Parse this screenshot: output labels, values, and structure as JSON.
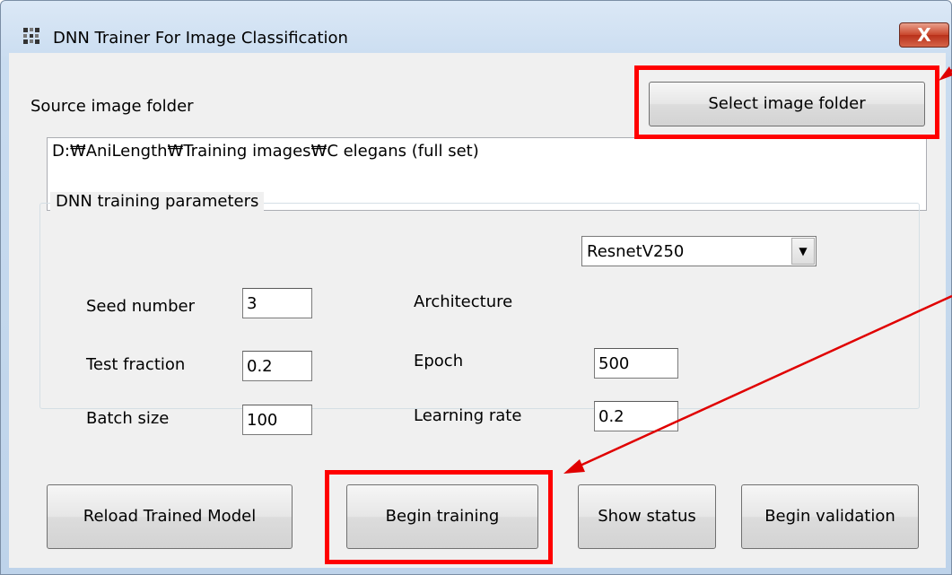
{
  "window": {
    "title": "DNN Trainer For Image Classification",
    "close_label": "X"
  },
  "source": {
    "label": "Source image folder",
    "select_button": "Select image folder",
    "path_value": "D:₩AniLength₩Training images₩C elegans (full set)"
  },
  "params": {
    "group_title": "DNN training parameters",
    "seed_label": "Seed number",
    "seed_value": "3",
    "test_fraction_label": "Test fraction",
    "test_fraction_value": "0.2",
    "batch_size_label": "Batch size",
    "batch_size_value": "100",
    "architecture_label": "Architecture",
    "architecture_value": "ResnetV250",
    "epoch_label": "Epoch",
    "epoch_value": "500",
    "learning_rate_label": "Learning rate",
    "learning_rate_value": "0.2"
  },
  "buttons": {
    "reload": "Reload Trained Model",
    "begin_training": "Begin training",
    "show_status": "Show status",
    "begin_validation": "Begin validation"
  },
  "colors": {
    "highlight": "#ff0000",
    "arrow": "#e00000"
  }
}
